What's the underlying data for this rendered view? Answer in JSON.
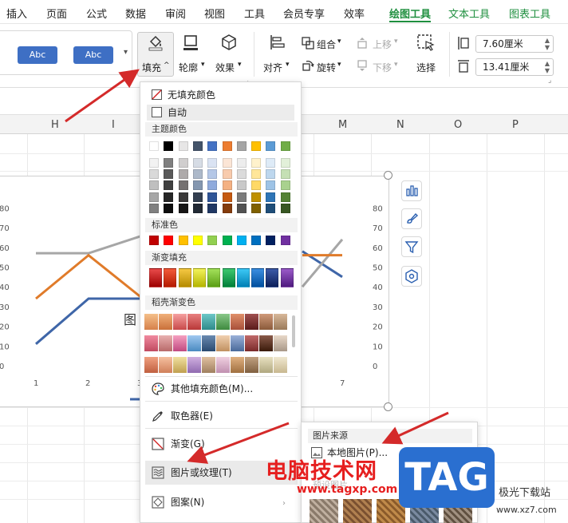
{
  "menu": {
    "items": [
      "插入",
      "页面",
      "公式",
      "数据",
      "审阅",
      "视图",
      "工具",
      "会员专享",
      "效率"
    ],
    "context_tabs": [
      "绘图工具",
      "文本工具",
      "图表工具"
    ]
  },
  "ribbon": {
    "styles": [
      "Abc",
      "Abc"
    ],
    "fill_label": "填充",
    "outline_label": "轮廓",
    "effect_label": "效果",
    "align_label": "对齐",
    "group_label": "组合",
    "rotate_label": "旋转",
    "move_up_label": "上移",
    "move_down_label": "下移",
    "select_label": "选择",
    "width_value": "7.60厘米",
    "height_value": "13.41厘米"
  },
  "sheet": {
    "columns": [
      "H",
      "I",
      "M",
      "N",
      "O",
      "P"
    ]
  },
  "chart": {
    "title_fragment": "图",
    "chart_data": {
      "type": "line",
      "x_ticks": [
        "1",
        "2",
        "3",
        "7"
      ],
      "left_ticks": [
        "80",
        "70",
        "60",
        "50",
        "40",
        "30",
        "20",
        "10",
        "0"
      ],
      "right_ticks": [
        "80",
        "70",
        "60",
        "50",
        "40",
        "30",
        "20",
        "10",
        "0"
      ],
      "ylim": [
        0,
        85
      ],
      "series": [
        {
          "color": "#a6a6a6",
          "values": [
            57,
            57,
            66
          ]
        },
        {
          "color": "#e07b2a",
          "values": [
            34,
            56,
            34
          ]
        },
        {
          "color": "#3f66a8",
          "values": [
            11,
            34,
            34
          ]
        }
      ],
      "right_segments": [
        {
          "color": "#3f66a8",
          "from": [
            6,
            58
          ],
          "to": [
            7,
            45
          ]
        },
        {
          "color": "#a6a6a6",
          "from": [
            6,
            40
          ],
          "to": [
            7,
            64
          ]
        },
        {
          "color": "#e07b2a",
          "from": [
            6,
            56
          ],
          "to": [
            7,
            56
          ]
        }
      ]
    }
  },
  "fill_menu": {
    "no_fill": "无填充颜色",
    "auto": "自动",
    "theme_colors_title": "主题颜色",
    "theme_top_row": [
      "#ffffff",
      "#000000",
      "#e7e6e6",
      "#44546a",
      "#4472c4",
      "#ed7d31",
      "#a5a5a5",
      "#ffc000",
      "#5b9bd5",
      "#70ad47"
    ],
    "theme_shade_cols": [
      [
        "#f2f2f2",
        "#d9d9d9",
        "#bfbfbf",
        "#a6a6a6",
        "#808080"
      ],
      [
        "#7f7f7f",
        "#595959",
        "#404040",
        "#262626",
        "#0d0d0d"
      ],
      [
        "#d0cece",
        "#aeaaaa",
        "#757171",
        "#3a3838",
        "#171616"
      ],
      [
        "#d6dce5",
        "#adb9ca",
        "#8497b0",
        "#333f50",
        "#222a35"
      ],
      [
        "#dae3f3",
        "#b4c7e7",
        "#8faadc",
        "#2f5597",
        "#203864"
      ],
      [
        "#fbe5d6",
        "#f8cbad",
        "#f4b183",
        "#c55a11",
        "#843c0c"
      ],
      [
        "#ededed",
        "#dbdbdb",
        "#c9c9c9",
        "#7b7b7b",
        "#525252"
      ],
      [
        "#fff2cc",
        "#ffe699",
        "#ffd966",
        "#bf9000",
        "#7f6000"
      ],
      [
        "#deebf7",
        "#bdd7ee",
        "#9dc3e6",
        "#2e75b6",
        "#1f4e79"
      ],
      [
        "#e2f0d9",
        "#c5e0b4",
        "#a9d18e",
        "#548235",
        "#385723"
      ]
    ],
    "standard_title": "标准色",
    "standard_colors": [
      "#c00000",
      "#ff0000",
      "#ffc000",
      "#ffff00",
      "#92d050",
      "#00b050",
      "#00b0f0",
      "#0070c0",
      "#002060",
      "#7030a0"
    ],
    "gradient_title": "渐变填充",
    "gradient_colors": [
      [
        "#e84a4a",
        "#9e0000"
      ],
      [
        "#f25a3a",
        "#b51a00"
      ],
      [
        "#f5c842",
        "#b58b00"
      ],
      [
        "#f2f25a",
        "#b5b500"
      ],
      [
        "#a3e05a",
        "#5a9e14"
      ],
      [
        "#3cc86e",
        "#007f3a"
      ],
      [
        "#3cc8f5",
        "#0080b5"
      ],
      [
        "#3c8ee0",
        "#004f9e"
      ],
      [
        "#3c5aa8",
        "#0d1f5a"
      ],
      [
        "#9a5ac8",
        "#4f1a7f"
      ]
    ],
    "husk_title": "稻壳渐变色",
    "husk_rows": [
      [
        [
          "#f5c08a",
          "#d6804a"
        ],
        [
          "#f0b07a",
          "#c9703a"
        ],
        [
          "#f5a0a0",
          "#c84a4a"
        ],
        [
          "#e88080",
          "#b83838"
        ],
        [
          "#6ec8c8",
          "#2e8a8a"
        ],
        [
          "#8ac88a",
          "#3e8a3e"
        ],
        [
          "#e0906a",
          "#a8503a"
        ],
        [
          "#a05050",
          "#5a1a1a"
        ],
        [
          "#d09a7a",
          "#8a5a3a"
        ],
        [
          "#d8b89a",
          "#9a7a5a"
        ]
      ],
      [
        [
          "#f08aa0",
          "#c04a60"
        ],
        [
          "#e8b0b0",
          "#b86a6a"
        ],
        [
          "#f5a0c0",
          "#c04a80"
        ],
        [
          "#a0c8f0",
          "#4a8ac0"
        ],
        [
          "#6a8ab0",
          "#2a4a70"
        ],
        [
          "#f0d0b0",
          "#c09060"
        ],
        [
          "#9ab0d8",
          "#4a6a9a"
        ],
        [
          "#c06a6a",
          "#7a2a2a"
        ],
        [
          "#8a5a4a",
          "#3a1a0a"
        ],
        [
          "#e8d8c8",
          "#a89888"
        ]
      ],
      [
        [
          "#f0a080",
          "#c06040"
        ],
        [
          "#f5c0a0",
          "#d0805a"
        ],
        [
          "#f0e0a0",
          "#c0a050"
        ],
        [
          "#d0b0e0",
          "#906ab0"
        ],
        [
          "#e0c0a0",
          "#a08060"
        ],
        [
          "#f0d0e0",
          "#c090b0"
        ],
        [
          "#e0b080",
          "#a07040"
        ],
        [
          "#c0a080",
          "#806040"
        ],
        [
          "#e8e0c0",
          "#b0a880"
        ],
        [
          "#f0e8d0",
          "#c8b890"
        ]
      ]
    ],
    "more_colors": "其他填充颜色(M)...",
    "eyedropper": "取色器(E)",
    "gradient": "渐变(G)",
    "picture_texture": "图片或纹理(T)",
    "pattern": "图案(N)"
  },
  "picture_submenu": {
    "title": "图片来源",
    "local_picture": "本地图片(P)...",
    "preset_label": "预设图片",
    "textures": [
      [
        "#8a7a6a",
        "#c0b0a0"
      ],
      [
        "#b08050",
        "#7a5030"
      ],
      [
        "#c08a4a",
        "#8a5a2a"
      ],
      [
        "#7a8aa0",
        "#4a5a6a"
      ],
      [
        "#a09080",
        "#605040"
      ]
    ]
  },
  "watermark": {
    "text": "电脑技术网",
    "url": "www.tagxp.com",
    "tag": "TAG",
    "site": "极光下载站",
    "site_url": "www.xz7.com"
  },
  "annotation_color": "#d42a2a"
}
